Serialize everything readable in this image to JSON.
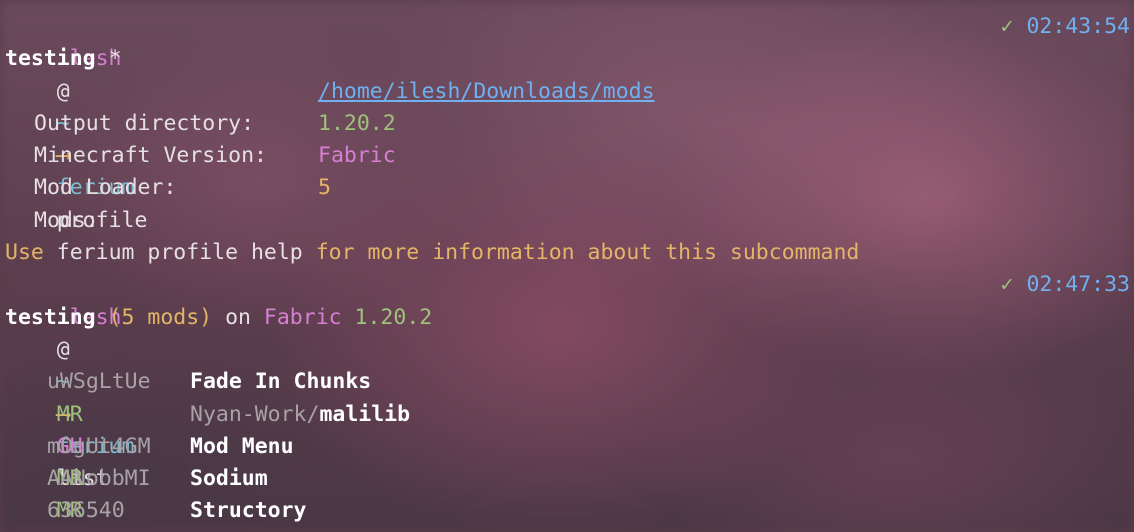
{
  "prompt1": {
    "user": "ilesh",
    "at": "@",
    "cwd": "~",
    "arrow": "⟶",
    "command": "ferium",
    "args": "profile",
    "check": "✓",
    "time": "02:43:54"
  },
  "profile": {
    "name": "testing",
    "active_marker": "*",
    "fields": [
      {
        "label": "Output directory:",
        "value": "/home/ilesh/Downloads/mods"
      },
      {
        "label": "Minecraft Version:",
        "value": "1.20.2"
      },
      {
        "label": "Mod Loader:",
        "value": "Fabric"
      },
      {
        "label": "Mods:",
        "value": "5"
      }
    ]
  },
  "help_hint": {
    "prefix": "Use",
    "command": "ferium profile help",
    "suffix": "for more information about this subcommand"
  },
  "prompt2": {
    "user": "ilesh",
    "at": "@",
    "cwd": "~",
    "arrow": "⟶",
    "command": "ferium",
    "args": "list",
    "check": "✓",
    "time": "02:47:33"
  },
  "list_header": {
    "profile": "testing",
    "count": "(5 mods)",
    "on": "on",
    "loader": "Fabric",
    "version": "1.20.2"
  },
  "mods": [
    {
      "source": "MR",
      "id": "uWSgLtUe",
      "owner": "",
      "name": "Fade In Chunks"
    },
    {
      "source": "GH",
      "id": "",
      "owner": "Nyan-Work/",
      "name": "malilib"
    },
    {
      "source": "MR",
      "id": "mOgUt4GM",
      "owner": "",
      "name": "Mod Menu"
    },
    {
      "source": "MR",
      "id": "AANobbMI",
      "owner": "",
      "name": "Sodium"
    },
    {
      "source": "CF",
      "id": "636540",
      "owner": "",
      "name": "Structory"
    }
  ],
  "colors": {
    "user": "#d77fd3",
    "command": "#7dbcd0",
    "args": "#e6e0e4",
    "link": "#6fb0f0",
    "version": "#9ec27a",
    "loader": "#d77fd3",
    "count": "#e5b567",
    "mr": "#9ec27a",
    "gh": "#d77fd3",
    "cf": "#ef6f6f",
    "time": "#6fb0f0"
  }
}
